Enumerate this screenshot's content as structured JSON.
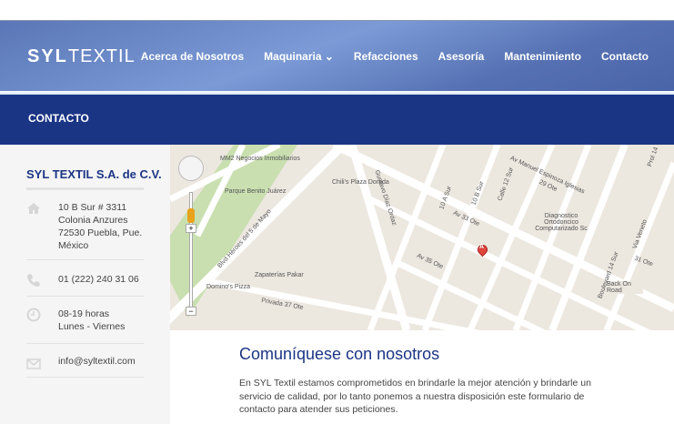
{
  "header": {
    "logo_bold": "SYL",
    "logo_light": "TEXTIL",
    "nav": [
      "Acerca de Nosotros",
      "Maquinaria",
      "Refacciones",
      "Asesoría",
      "Mantenimiento",
      "Contacto"
    ],
    "dropdown_indicator": "⌄"
  },
  "page_title": "CONTACTO",
  "sidebar": {
    "company": "SYL TEXTIL S.A. de C.V.",
    "address": [
      "10 B Sur # 3311",
      "Colonia Anzures",
      "72530 Puebla, Pue.",
      "México"
    ],
    "phone": "01 (222) 240 31 06",
    "hours": [
      "08-19 horas",
      "Lunes - Viernes"
    ],
    "email": "info@syltextil.com"
  },
  "map": {
    "labels": [
      "MM2 Negocios Inmobiliarios",
      "Parque Benito Juárez",
      "Chili's Plaza Dorada",
      "Blvd Héroes del 5 de Mayo",
      "Gustavo Díaz Ordaz",
      "Zapaterías Pakar",
      "Domino's Pizza",
      "Privada 37 Ote",
      "Av 33 Ote",
      "Av 35 Ote",
      "Av Manuel Espinoza Iglesias",
      "Diagnostico Ortodoncico Computarizado Sc",
      "Back On Road",
      "31 Ote",
      "29 Ote",
      "Boulevard 14 Sur",
      "Calle 12 Sur",
      "10 A Sur",
      "10 B Sur",
      "Via Veneto",
      "Prol 14"
    ],
    "marker": "A"
  },
  "main": {
    "title": "Comuníquese con nosotros",
    "text": "En SYL Textil estamos comprometidos en brindarle la mejor atención y brindarle un servicio de calidad, por lo tanto ponemos a nuestra disposición este formulario de contacto para atender sus peticiones."
  }
}
